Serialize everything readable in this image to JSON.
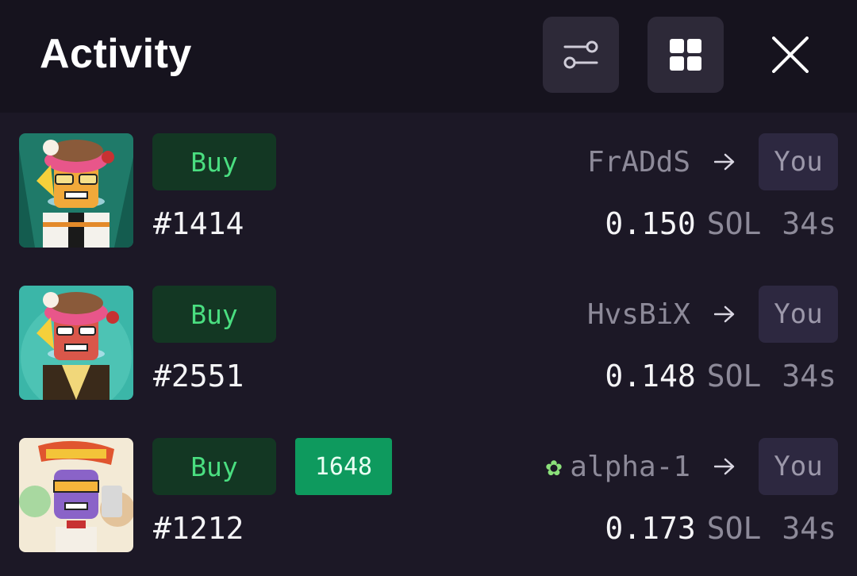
{
  "header": {
    "title": "Activity",
    "filter_icon": "sliders-icon",
    "grid_icon": "grid-icon",
    "close_icon": "close-icon"
  },
  "colors": {
    "background": "#1c1826",
    "header_bg": "#16131e",
    "buy_bg": "#133723",
    "buy_text": "#4ade80",
    "badge_bg": "#0e9a5e",
    "you_bg": "#2d2840"
  },
  "activity": [
    {
      "action": "Buy",
      "token": "#1414",
      "from": "FrADdS",
      "to": "You",
      "amount": "0.150",
      "currency": "SOL",
      "age": "34s"
    },
    {
      "action": "Buy",
      "token": "#2551",
      "from": "HvsBiX",
      "to": "You",
      "amount": "0.148",
      "currency": "SOL",
      "age": "34s"
    },
    {
      "action": "Buy",
      "rank": "1648",
      "token": "#1212",
      "from": "alpha-1",
      "from_icon": "gear-badge-icon",
      "to": "You",
      "amount": "0.173",
      "currency": "SOL",
      "age": "34s"
    }
  ]
}
